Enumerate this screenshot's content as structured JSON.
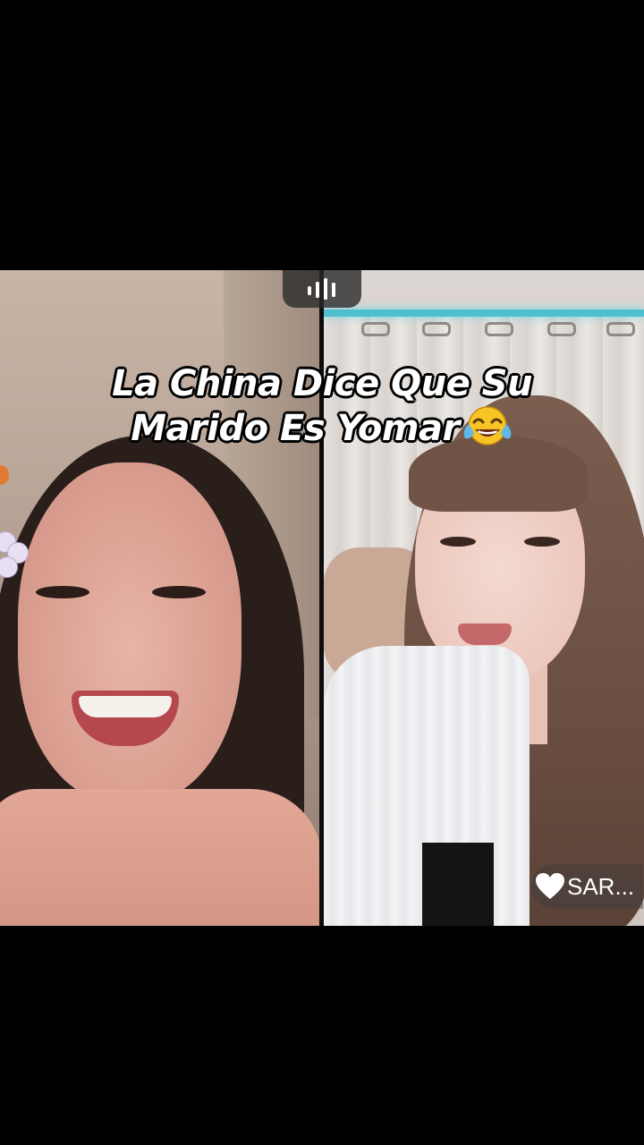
{
  "caption": {
    "line1": "La China Dice Que Su",
    "line2": "Marido Es Yomar",
    "emoji_icon": "face-with-tears-of-joy-icon"
  },
  "audio_indicator": {
    "icon": "sound-bars-icon"
  },
  "user_tag": {
    "icon": "heart-icon",
    "label": "SAR..."
  },
  "colors": {
    "background": "#000000",
    "caption_text": "#ffffff",
    "caption_outline": "#000000",
    "curtain_light": "#4dbfd0",
    "divider": "#0d0d0d"
  }
}
